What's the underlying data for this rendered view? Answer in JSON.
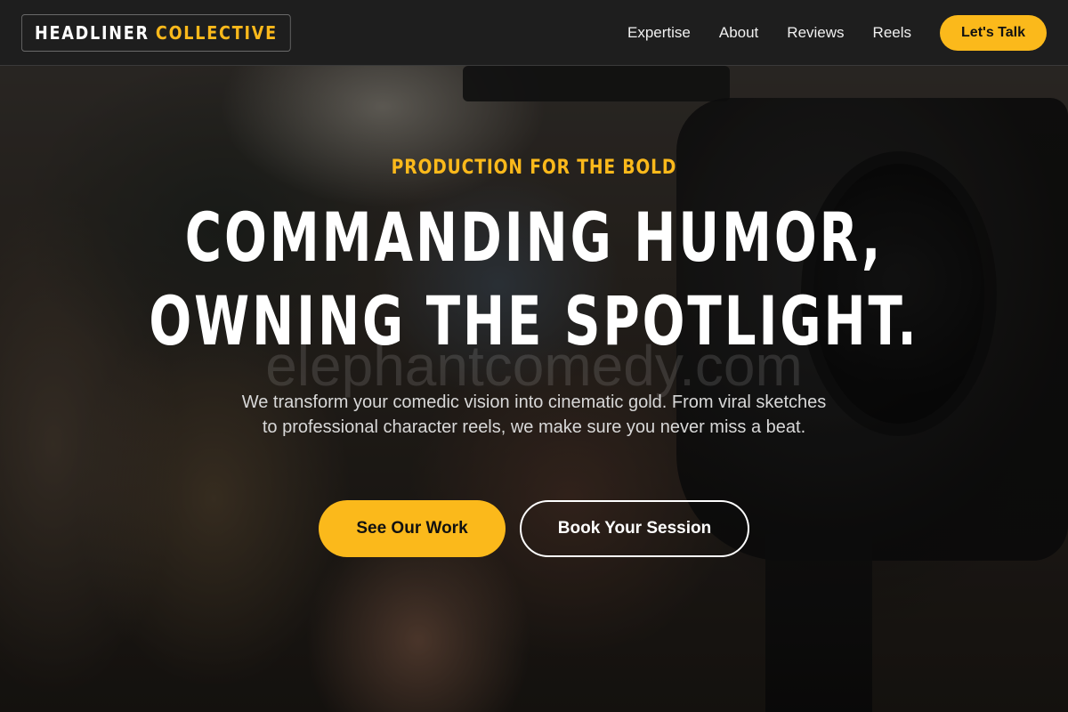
{
  "logo": {
    "part1": "HEADLINER",
    "part2": "COLLECTIVE"
  },
  "nav": {
    "links": [
      "Expertise",
      "About",
      "Reviews",
      "Reels"
    ],
    "cta": "Let's Talk"
  },
  "hero": {
    "eyebrow": "PRODUCTION FOR THE BOLD",
    "headline_line1": "COMMANDING HUMOR,",
    "headline_line2": "OWNING THE SPOTLIGHT.",
    "watermark": "elephantcomedy.com",
    "subtext": "We transform your comedic vision into cinematic gold. From viral sketches to professional character reels, we make sure you never miss a beat.",
    "primary_button": "See Our Work",
    "secondary_button": "Book Your Session"
  },
  "colors": {
    "accent": "#fbb91b",
    "navbar_bg": "#1e1e1e",
    "text_primary": "#ffffff"
  }
}
